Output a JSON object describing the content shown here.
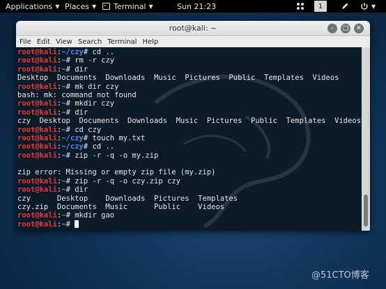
{
  "topbar": {
    "applications": "Applications",
    "places": "Places",
    "terminal": "Terminal",
    "clock": "Sun 21:23",
    "workspace": "1",
    "icons": [
      "apps-icon",
      "pen-icon",
      "power-icon"
    ]
  },
  "window": {
    "title": "root@kali: ~",
    "menu": [
      "File",
      "Edit",
      "View",
      "Search",
      "Terminal",
      "Help"
    ]
  },
  "terminal": {
    "prompt_user": "root@kali",
    "lines": [
      {
        "type": "prompt",
        "path": "~/czy",
        "cmd": "cd .."
      },
      {
        "type": "prompt",
        "path": "~",
        "cmd": "rm -r czy"
      },
      {
        "type": "prompt",
        "path": "~",
        "cmd": "dir"
      },
      {
        "type": "output",
        "text": "Desktop  Documents  Downloads  Music  Pictures  Public  Templates  Videos"
      },
      {
        "type": "prompt",
        "path": "~",
        "cmd": "mk dir czy"
      },
      {
        "type": "output",
        "text": "bash: mk: command not found"
      },
      {
        "type": "prompt",
        "path": "~",
        "cmd": "mkdir czy"
      },
      {
        "type": "prompt",
        "path": "~",
        "cmd": "dir"
      },
      {
        "type": "output",
        "text": "czy  Desktop  Documents  Downloads  Music  Pictures  Public  Templates  Videos"
      },
      {
        "type": "prompt",
        "path": "~",
        "cmd": "cd czy"
      },
      {
        "type": "prompt",
        "path": "~/czy",
        "cmd": "touch my.txt"
      },
      {
        "type": "prompt",
        "path": "~/czy",
        "cmd": "cd .."
      },
      {
        "type": "prompt",
        "path": "~",
        "cmd": "zip -r -q -o my.zip"
      },
      {
        "type": "output",
        "text": ""
      },
      {
        "type": "output",
        "text": "zip error: Missing or empty zip file (my.zip)"
      },
      {
        "type": "prompt",
        "path": "~",
        "cmd": "zip -r -q -o czy.zip czy"
      },
      {
        "type": "prompt",
        "path": "~",
        "cmd": "dir"
      },
      {
        "type": "output",
        "text": "czy      Desktop    Downloads  Pictures  Templates"
      },
      {
        "type": "output",
        "text": "czy.zip  Documents  Music      Public    Videos"
      },
      {
        "type": "prompt",
        "path": "~",
        "cmd": "mkdir gao"
      },
      {
        "type": "prompt",
        "path": "~",
        "cmd": "",
        "cursor": true
      }
    ]
  },
  "credit": "@51CTO博客"
}
